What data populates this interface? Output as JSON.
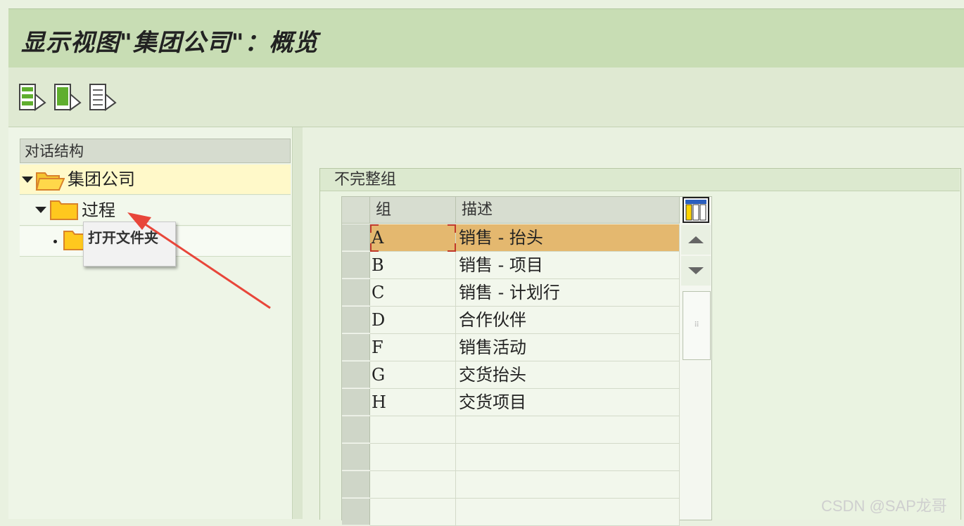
{
  "window": {
    "title": "显示视图\"集团公司\"：概览"
  },
  "toolbar": {
    "buttons": [
      {
        "icon": "select-all-icon"
      },
      {
        "icon": "select-block-icon"
      },
      {
        "icon": "deselect-all-icon"
      }
    ]
  },
  "tree": {
    "header": "对话结构",
    "items": [
      {
        "label": "集团公司",
        "expanded": true,
        "icon": "folder-open-icon"
      },
      {
        "label": "过程",
        "expanded": true,
        "icon": "folder-icon"
      },
      {
        "label": "",
        "icon": "folder-icon"
      }
    ],
    "tooltip": "打开文件夹"
  },
  "group_panel": {
    "title": "不完整组",
    "columns": [
      "组",
      "描述"
    ],
    "rows": [
      {
        "group": "A",
        "desc": "销售 - 抬头"
      },
      {
        "group": "B",
        "desc": "销售 - 项目"
      },
      {
        "group": "C",
        "desc": "销售 - 计划行"
      },
      {
        "group": "D",
        "desc": "合作伙伴"
      },
      {
        "group": "F",
        "desc": "销售活动"
      },
      {
        "group": "G",
        "desc": "交货抬头"
      },
      {
        "group": "H",
        "desc": "交货项目"
      }
    ],
    "selected_row": 0
  },
  "colors": {
    "selected_row": "#e4b86f",
    "titlebar": "#c8ddb4",
    "arrow": "#e8463a"
  },
  "watermark": "CSDN @SAP龙哥"
}
